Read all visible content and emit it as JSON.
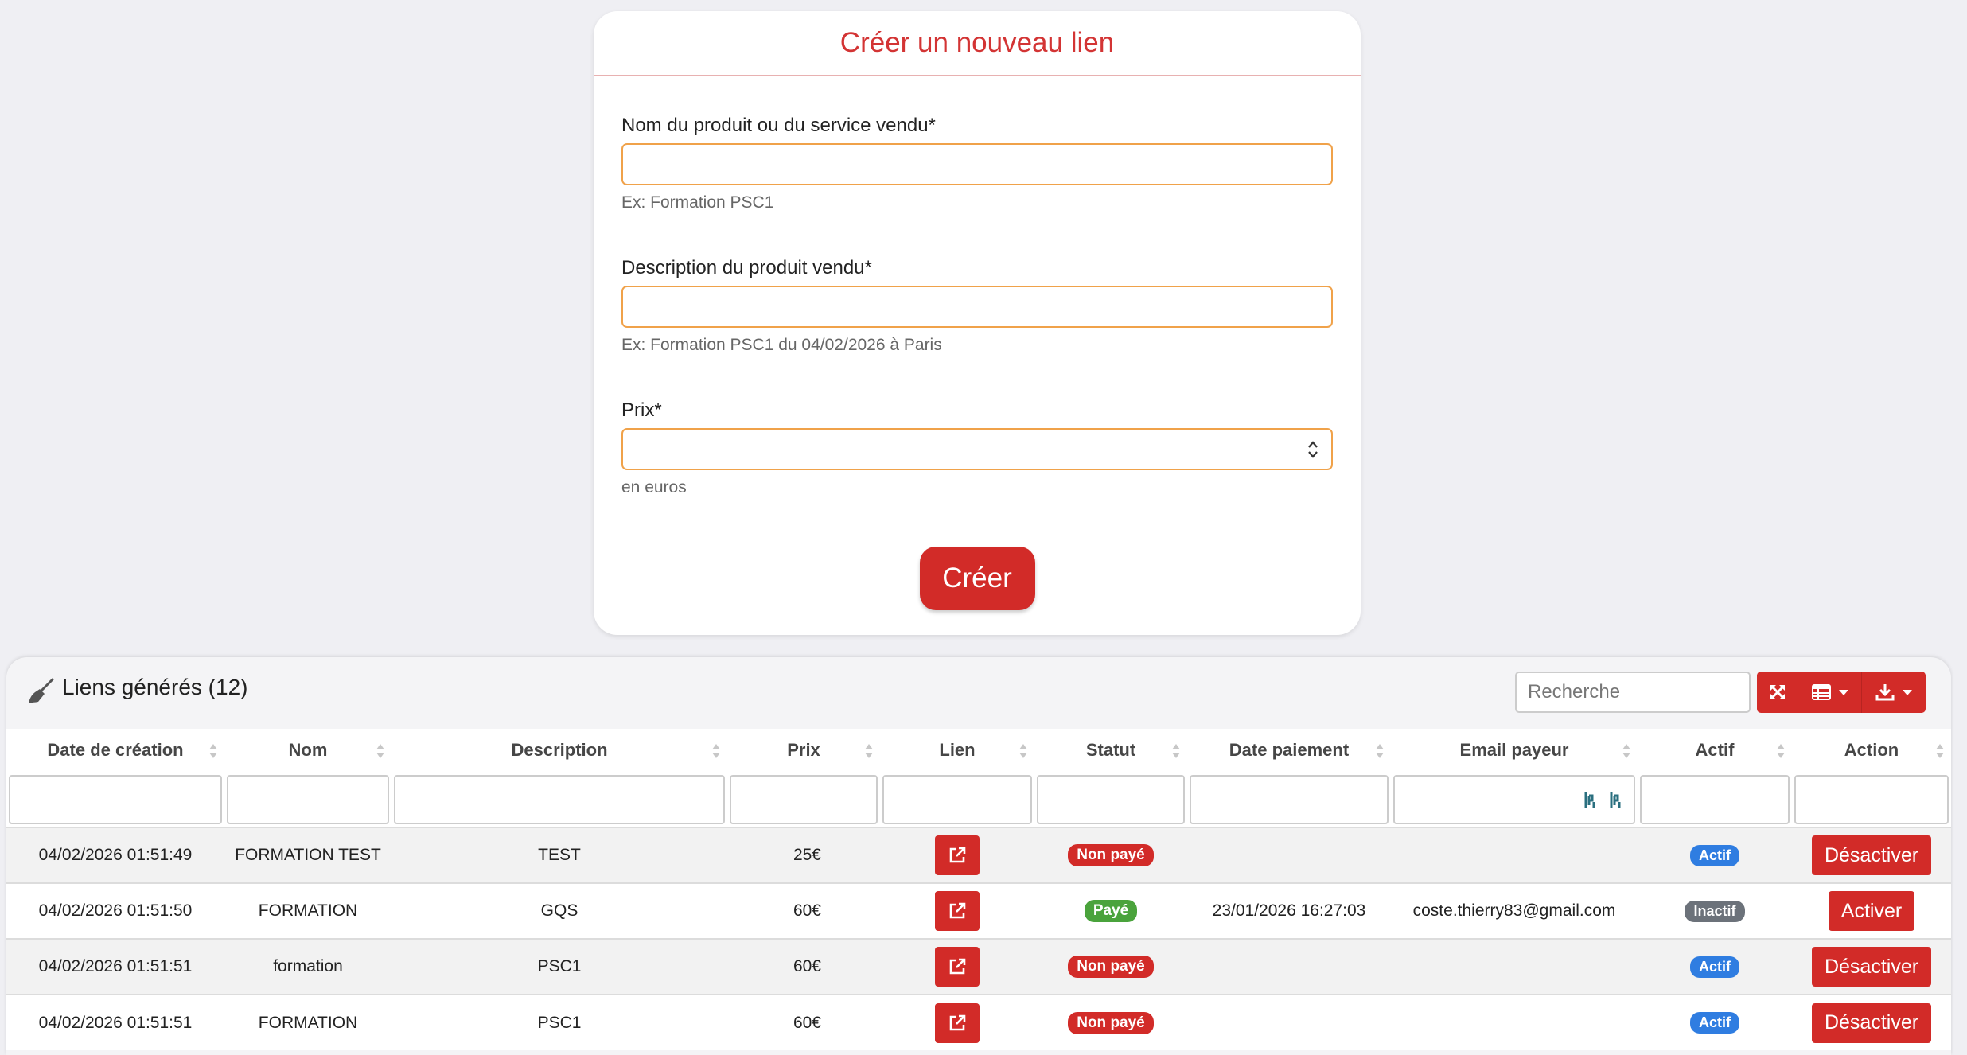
{
  "form": {
    "title": "Créer un nouveau lien",
    "fields": [
      {
        "label": "Nom du produit ou du service vendu*",
        "value": "",
        "help": "Ex: Formation PSC1"
      },
      {
        "label": "Description du produit vendu*",
        "value": "",
        "help": "Ex: Formation PSC1 du 04/02/2026 à Paris"
      },
      {
        "label": "Prix*",
        "value": "",
        "help": "en euros"
      }
    ],
    "submit_label": "Créer"
  },
  "table": {
    "title": "Liens générés (12)",
    "search_placeholder": "Recherche",
    "columns": [
      "Date de création",
      "Nom",
      "Description",
      "Prix",
      "Lien",
      "Statut",
      "Date paiement",
      "Email payeur",
      "Actif",
      "Action"
    ],
    "rows": [
      {
        "date": "04/02/2026 01:51:49",
        "nom": "FORMATION TEST",
        "description": "TEST",
        "prix": "25€",
        "statut": "Non payé",
        "statut_type": "unpaid",
        "date_paiement": "",
        "email": "",
        "actif": "Actif",
        "actif_type": "active",
        "action": "Désactiver"
      },
      {
        "date": "04/02/2026 01:51:50",
        "nom": "FORMATION",
        "description": "GQS",
        "prix": "60€",
        "statut": "Payé",
        "statut_type": "paid",
        "date_paiement": "23/01/2026 16:27:03",
        "email": "coste.thierry83@gmail.com",
        "actif": "Inactif",
        "actif_type": "inactive",
        "action": "Activer"
      },
      {
        "date": "04/02/2026 01:51:51",
        "nom": "formation",
        "description": "PSC1",
        "prix": "60€",
        "statut": "Non payé",
        "statut_type": "unpaid",
        "date_paiement": "",
        "email": "",
        "actif": "Actif",
        "actif_type": "active",
        "action": "Désactiver"
      },
      {
        "date": "04/02/2026 01:51:51",
        "nom": "FORMATION",
        "description": "PSC1",
        "prix": "60€",
        "statut": "Non payé",
        "statut_type": "unpaid",
        "date_paiement": "",
        "email": "",
        "actif": "Actif",
        "actif_type": "active",
        "action": "Désactiver"
      }
    ]
  },
  "colors": {
    "accent": "#d22b28",
    "title_red": "#d33434",
    "input_border": "#f0a24a",
    "badge_active": "#2f7de1",
    "badge_inactive": "#6c727a",
    "badge_paid": "#4aa33c"
  },
  "icons": [
    "broom-icon",
    "expand-icon",
    "table-columns-icon",
    "download-icon",
    "external-link-icon",
    "sort-icon",
    "number-spinner-icon"
  ]
}
